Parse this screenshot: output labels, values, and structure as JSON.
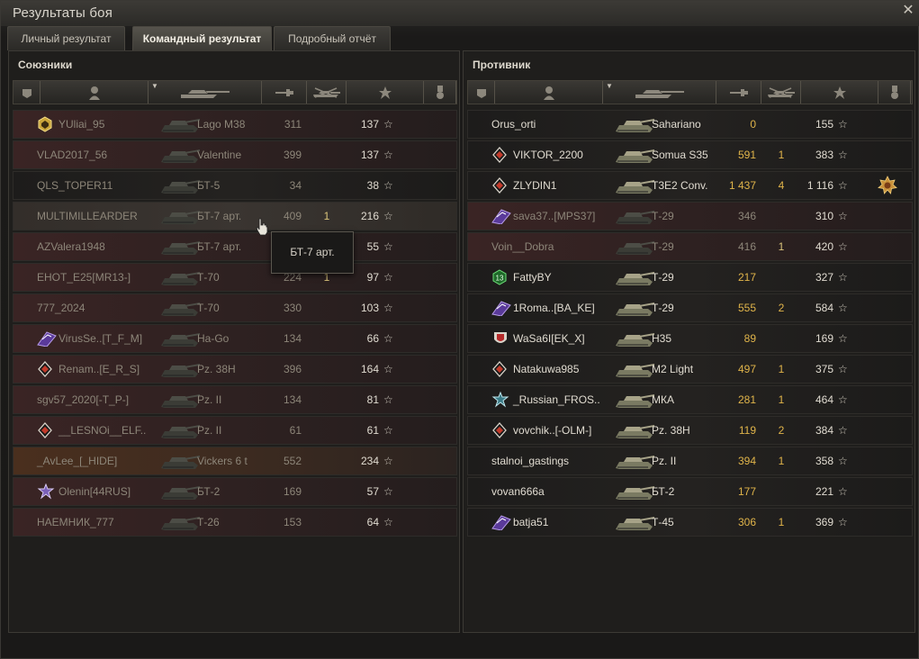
{
  "window": {
    "title": "Результаты боя",
    "close_glyph": "✕"
  },
  "tabs": [
    "Личный результат",
    "Командный результат",
    "Подробный отчёт"
  ],
  "active_tab": 1,
  "left": {
    "title": "Союзники",
    "rows": [
      {
        "name": "YUliai_95",
        "vehicle": "Lago M38",
        "damage": "311",
        "kills": "",
        "xp": "137",
        "alive": false,
        "badge": "gold-hex",
        "style": "red-tint"
      },
      {
        "name": "VLAD2017_56",
        "vehicle": "Valentine",
        "damage": "399",
        "kills": "",
        "xp": "137",
        "alive": false,
        "badge": "",
        "style": "red-tint"
      },
      {
        "name": "QLS_TOPER11",
        "vehicle": "БТ-5",
        "damage": "34",
        "kills": "",
        "xp": "38",
        "alive": false,
        "badge": "",
        "style": ""
      },
      {
        "name": "MULTIMILLEARDER",
        "vehicle": "БТ-7 арт.",
        "damage": "409",
        "kills": "1",
        "xp": "216",
        "alive": false,
        "badge": "",
        "style": "hl"
      },
      {
        "name": "AZValera1948",
        "vehicle": "БТ-7 арт.",
        "damage": "",
        "kills": "",
        "xp": "55",
        "alive": false,
        "badge": "",
        "style": "red-tint"
      },
      {
        "name": "EHOT_E25[MR13-]",
        "vehicle": "Т-70",
        "damage": "224",
        "kills": "1",
        "xp": "97",
        "alive": false,
        "badge": "",
        "style": "red-tint"
      },
      {
        "name": "777_2024",
        "vehicle": "Т-70",
        "damage": "330",
        "kills": "",
        "xp": "103",
        "alive": false,
        "badge": "",
        "style": "red-tint"
      },
      {
        "name": "VirusSe..[T_F_M]",
        "vehicle": "Ha-Go",
        "damage": "134",
        "kills": "",
        "xp": "66",
        "alive": false,
        "badge": "purple-flag",
        "style": "red-tint"
      },
      {
        "name": "Renam..[E_R_S]",
        "vehicle": "Pz. 38H",
        "damage": "396",
        "kills": "",
        "xp": "164",
        "alive": false,
        "badge": "red-diamond",
        "style": "red-tint"
      },
      {
        "name": "sgv57_2020[-T_P-]",
        "vehicle": "Pz. II",
        "damage": "134",
        "kills": "",
        "xp": "81",
        "alive": false,
        "badge": "",
        "style": "red-tint"
      },
      {
        "name": "__LESNOi__ELF..",
        "vehicle": "Pz. II",
        "damage": "61",
        "kills": "",
        "xp": "61",
        "alive": false,
        "badge": "red-diamond",
        "style": "red-tint"
      },
      {
        "name": "_AvLee_[_HIDE]",
        "vehicle": "Vickers 6 t",
        "damage": "552",
        "kills": "",
        "xp": "234",
        "alive": false,
        "badge": "",
        "style": "orange"
      },
      {
        "name": "Olenin[44RUS]",
        "vehicle": "БТ-2",
        "damage": "169",
        "kills": "",
        "xp": "57",
        "alive": false,
        "badge": "purple-star",
        "style": "red-tint"
      },
      {
        "name": "НАЕМНИК_777",
        "vehicle": "Т-26",
        "damage": "153",
        "kills": "",
        "xp": "64",
        "alive": false,
        "badge": "",
        "style": "red-tint"
      }
    ]
  },
  "right": {
    "title": "Противник",
    "rows": [
      {
        "name": "Orus_orti",
        "vehicle": "Sahariano",
        "damage": "0",
        "kills": "",
        "xp": "155",
        "alive": true,
        "badge": "",
        "style": ""
      },
      {
        "name": "VIKTOR_2200",
        "vehicle": "Somua S35",
        "damage": "591",
        "kills": "1",
        "xp": "383",
        "alive": true,
        "badge": "red-diamond",
        "style": ""
      },
      {
        "name": "ZLYDIN1",
        "vehicle": "T3E2 Conv.",
        "damage": "1 437",
        "kills": "4",
        "xp": "1 116",
        "alive": true,
        "badge": "red-diamond",
        "style": "",
        "medal": true
      },
      {
        "name": "sava37..[MPS37]",
        "vehicle": "Т-29",
        "damage": "346",
        "kills": "",
        "xp": "310",
        "alive": false,
        "badge": "purple-flag",
        "style": "red-tint"
      },
      {
        "name": "Voin__Dobra",
        "vehicle": "Т-29",
        "damage": "416",
        "kills": "1",
        "xp": "420",
        "alive": false,
        "badge": "",
        "style": "red-tint"
      },
      {
        "name": "FattyBY",
        "vehicle": "Т-29",
        "damage": "217",
        "kills": "",
        "xp": "327",
        "alive": true,
        "badge": "green-13",
        "style": ""
      },
      {
        "name": "1Roma..[BA_KE]",
        "vehicle": "Т-29",
        "damage": "555",
        "kills": "2",
        "xp": "584",
        "alive": true,
        "badge": "purple-flag",
        "style": ""
      },
      {
        "name": "WaSa6I[EK_X]",
        "vehicle": "H35",
        "damage": "89",
        "kills": "",
        "xp": "169",
        "alive": true,
        "badge": "red-shield",
        "style": ""
      },
      {
        "name": "Natakuwa985",
        "vehicle": "M2 Light",
        "damage": "497",
        "kills": "1",
        "xp": "375",
        "alive": true,
        "badge": "red-diamond",
        "style": ""
      },
      {
        "name": "_Russian_FROS..",
        "vehicle": "МКА",
        "damage": "281",
        "kills": "1",
        "xp": "464",
        "alive": true,
        "badge": "teal-star",
        "style": ""
      },
      {
        "name": "vovchik..[-OLM-]",
        "vehicle": "Pz. 38H",
        "damage": "119",
        "kills": "2",
        "xp": "384",
        "alive": true,
        "badge": "red-diamond",
        "style": ""
      },
      {
        "name": "stalnoi_gastings",
        "vehicle": "Pz. II",
        "damage": "394",
        "kills": "1",
        "xp": "358",
        "alive": true,
        "badge": "",
        "style": ""
      },
      {
        "name": "vovan666a",
        "vehicle": "БТ-2",
        "damage": "177",
        "kills": "",
        "xp": "221",
        "alive": true,
        "badge": "",
        "style": ""
      },
      {
        "name": "batja51",
        "vehicle": "Т-45",
        "damage": "306",
        "kills": "1",
        "xp": "369",
        "alive": true,
        "badge": "purple-flag",
        "style": ""
      }
    ]
  },
  "tooltip": "БТ-7 арт.",
  "colors": {
    "alive_text": "#e0dbd0",
    "dead_text": "#8d8679",
    "damage": "#e0b44a",
    "xp_text": "#e0dbd0",
    "panel_bg": "#1f1e1c"
  },
  "icons": [
    "close-icon",
    "squad-icon",
    "player-icon",
    "tank-icon",
    "damage-icon",
    "kills-icon",
    "xp-star-icon",
    "medal-icon"
  ]
}
